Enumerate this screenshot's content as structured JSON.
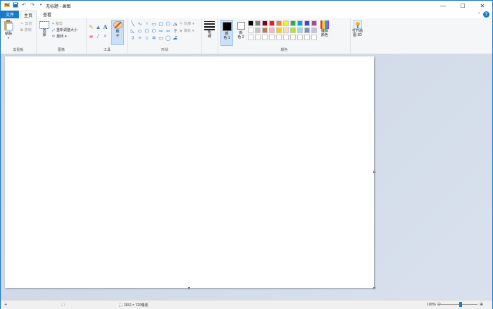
{
  "window": {
    "title": "无标题 - 画图"
  },
  "tabs": {
    "file": "文件",
    "home": "主页",
    "view": "查看"
  },
  "clipboard": {
    "paste": "粘贴",
    "cut": "剪切",
    "copy": "复制",
    "group": "剪贴板"
  },
  "image": {
    "select": "选\n择",
    "crop": "裁剪",
    "resize": "重新调整大小",
    "rotate": "旋转",
    "group": "图像"
  },
  "tools": {
    "group": "工具",
    "brushes": "刷\n子"
  },
  "shapes": {
    "outline": "轮廓",
    "fill": "填充",
    "group": "形状"
  },
  "size": {
    "label": "粗\n细"
  },
  "colors": {
    "color1": "颜\n色 1",
    "color2": "颜\n色 2",
    "edit": "编辑\n颜色",
    "group": "颜色",
    "primary": "#000000",
    "secondary": "#ffffff",
    "palette": [
      "#000000",
      "#7f7f7f",
      "#880015",
      "#ed1c24",
      "#ff7f27",
      "#fff200",
      "#22b14c",
      "#00a2e8",
      "#3f48cc",
      "#a349a4",
      "#ffffff",
      "#c3c3c3",
      "#b97a57",
      "#ffaec9",
      "#ffc90e",
      "#efe4b0",
      "#b5e61d",
      "#99d9ea",
      "#7092be",
      "#c8bfe7",
      "#ffffff",
      "#ffffff",
      "#ffffff",
      "#ffffff",
      "#ffffff",
      "#ffffff",
      "#ffffff",
      "#ffffff",
      "#ffffff",
      "#ffffff"
    ]
  },
  "paint3d": {
    "label": "打开画\n图 3D"
  },
  "status": {
    "dimensions": "1152 × 720像素",
    "zoom": "100%"
  }
}
